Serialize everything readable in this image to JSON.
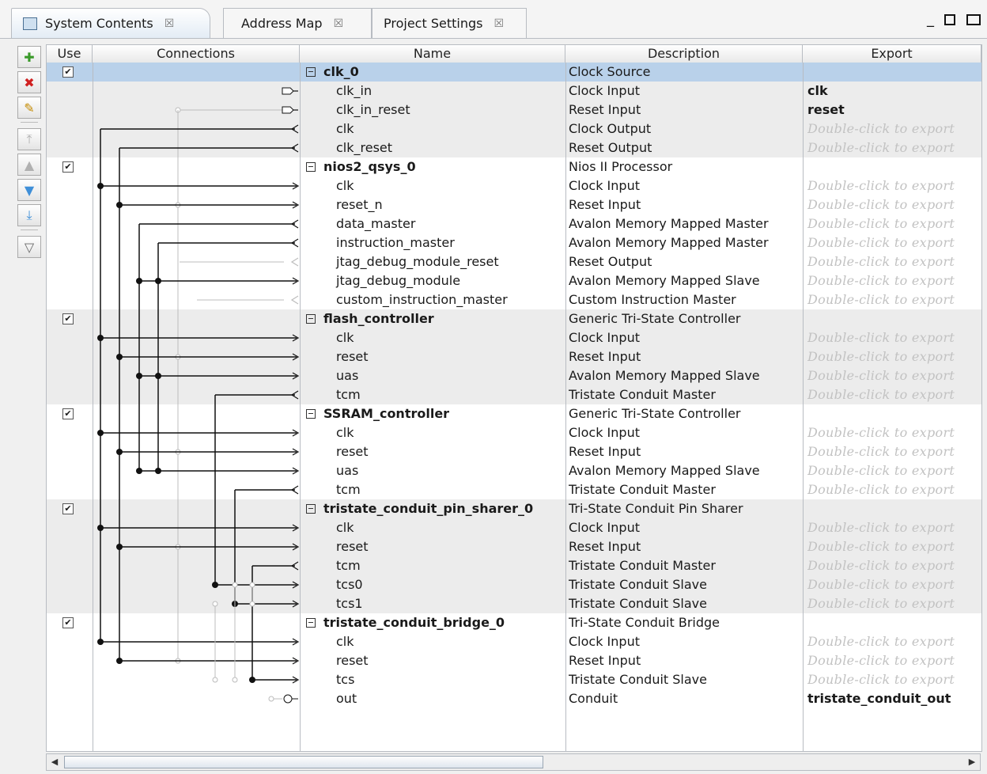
{
  "tabs": [
    {
      "label": "System Contents"
    },
    {
      "label": "Address Map"
    },
    {
      "label": "Project Settings"
    }
  ],
  "close_glyph": "☒",
  "window_controls": {
    "minimize": "_",
    "maximize": "□"
  },
  "columns": {
    "use": "Use",
    "connections": "Connections",
    "name": "Name",
    "description": "Description",
    "export": "Export"
  },
  "export_hint": "Double-click to export",
  "rows": [
    {
      "name": "clk_0",
      "desc": "Clock Source",
      "export": "",
      "group": true,
      "selected": true,
      "checked": true
    },
    {
      "name": "clk_in",
      "desc": "Clock Input",
      "export": "clk"
    },
    {
      "name": "clk_in_reset",
      "desc": "Reset Input",
      "export": "reset"
    },
    {
      "name": "clk",
      "desc": "Clock Output",
      "export": "Double-click to export"
    },
    {
      "name": "clk_reset",
      "desc": "Reset Output",
      "export": "Double-click to export"
    },
    {
      "name": "nios2_qsys_0",
      "desc": "Nios II Processor",
      "export": "",
      "group": true,
      "checked": true
    },
    {
      "name": "clk",
      "desc": "Clock Input",
      "export": "Double-click to export"
    },
    {
      "name": "reset_n",
      "desc": "Reset Input",
      "export": "Double-click to export"
    },
    {
      "name": "data_master",
      "desc": "Avalon Memory Mapped Master",
      "export": "Double-click to export"
    },
    {
      "name": "instruction_master",
      "desc": "Avalon Memory Mapped Master",
      "export": "Double-click to export"
    },
    {
      "name": "jtag_debug_module_reset",
      "desc": "Reset Output",
      "export": "Double-click to export"
    },
    {
      "name": "jtag_debug_module",
      "desc": "Avalon Memory Mapped Slave",
      "export": "Double-click to export"
    },
    {
      "name": "custom_instruction_master",
      "desc": "Custom Instruction Master",
      "export": "Double-click to export"
    },
    {
      "name": "flash_controller",
      "desc": "Generic Tri-State Controller",
      "export": "",
      "group": true,
      "checked": true
    },
    {
      "name": "clk",
      "desc": "Clock Input",
      "export": "Double-click to export"
    },
    {
      "name": "reset",
      "desc": "Reset Input",
      "export": "Double-click to export"
    },
    {
      "name": "uas",
      "desc": "Avalon Memory Mapped Slave",
      "export": "Double-click to export"
    },
    {
      "name": "tcm",
      "desc": "Tristate Conduit Master",
      "export": "Double-click to export"
    },
    {
      "name": "SSRAM_controller",
      "desc": "Generic Tri-State Controller",
      "export": "",
      "group": true,
      "checked": true
    },
    {
      "name": "clk",
      "desc": "Clock Input",
      "export": "Double-click to export"
    },
    {
      "name": "reset",
      "desc": "Reset Input",
      "export": "Double-click to export"
    },
    {
      "name": "uas",
      "desc": "Avalon Memory Mapped Slave",
      "export": "Double-click to export"
    },
    {
      "name": "tcm",
      "desc": "Tristate Conduit Master",
      "export": "Double-click to export"
    },
    {
      "name": "tristate_conduit_pin_sharer_0",
      "desc": "Tri-State Conduit Pin Sharer",
      "export": "",
      "group": true,
      "checked": true
    },
    {
      "name": "clk",
      "desc": "Clock Input",
      "export": "Double-click to export"
    },
    {
      "name": "reset",
      "desc": "Reset Input",
      "export": "Double-click to export"
    },
    {
      "name": "tcm",
      "desc": "Tristate Conduit Master",
      "export": "Double-click to export"
    },
    {
      "name": "tcs0",
      "desc": "Tristate Conduit Slave",
      "export": "Double-click to export"
    },
    {
      "name": "tcs1",
      "desc": "Tristate Conduit Slave",
      "export": "Double-click to export"
    },
    {
      "name": "tristate_conduit_bridge_0",
      "desc": "Tri-State Conduit Bridge",
      "export": "",
      "group": true,
      "checked": true
    },
    {
      "name": "clk",
      "desc": "Clock Input",
      "export": "Double-click to export"
    },
    {
      "name": "reset",
      "desc": "Reset Input",
      "export": "Double-click to export"
    },
    {
      "name": "tcs",
      "desc": "Tristate Conduit Slave",
      "export": "Double-click to export"
    },
    {
      "name": "out",
      "desc": "Conduit",
      "export": "tristate_conduit_out"
    }
  ],
  "groups_shaded": [
    5,
    18,
    29
  ],
  "toolbar": [
    {
      "icon": "add-icon",
      "glyph": "✚",
      "color": "#3a9a2a"
    },
    {
      "icon": "remove-icon",
      "glyph": "✖",
      "color": "#d02020"
    },
    {
      "icon": "edit-icon",
      "glyph": "✎",
      "color": "#c48a00"
    },
    {
      "icon": "move-top-icon",
      "glyph": "⤒",
      "color": "#b0b0b0"
    },
    {
      "icon": "move-up-icon",
      "glyph": "▲",
      "color": "#b0b0b0"
    },
    {
      "icon": "move-down-icon",
      "glyph": "▼",
      "color": "#3f8fd8"
    },
    {
      "icon": "move-bottom-icon",
      "glyph": "⤓",
      "color": "#3f8fd8"
    },
    {
      "icon": "filter-icon",
      "glyph": "▽",
      "color": "#666666"
    }
  ]
}
